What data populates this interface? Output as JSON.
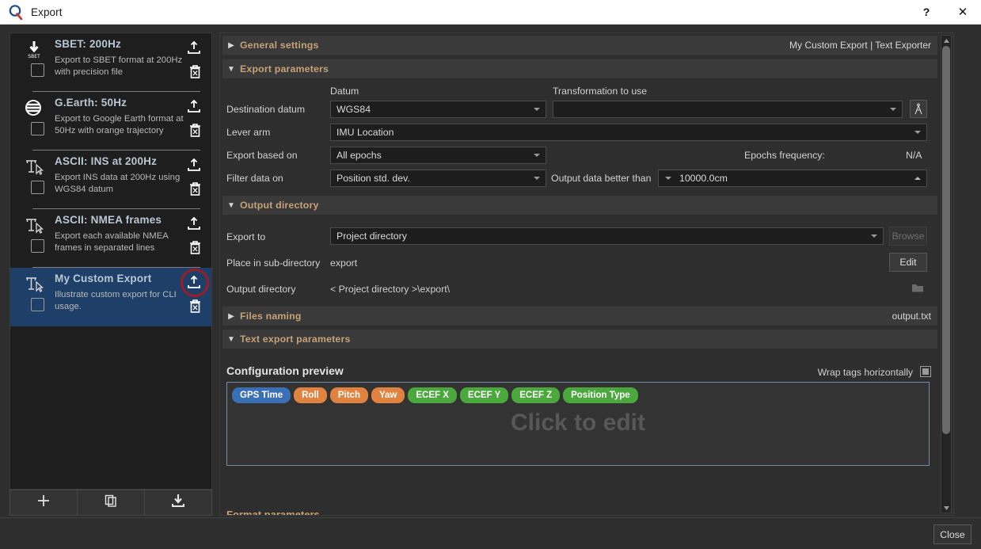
{
  "window": {
    "title": "Export",
    "logo_icon": "app-logo-icon",
    "help_label": "?",
    "close_label": "✕"
  },
  "sidebar": {
    "items": [
      {
        "icon": "sbet-download-icon",
        "title": "SBET: 200Hz",
        "description": "Export to SBET format at 200Hz with precision file",
        "checked": false,
        "selected": false,
        "upload_icon": "upload-icon",
        "delete_icon": "trash-icon"
      },
      {
        "icon": "google-earth-globe-icon",
        "title": "G.Earth: 50Hz",
        "description": "Export to Google Earth format at 50Hz with orange trajectory",
        "checked": false,
        "selected": false,
        "upload_icon": "upload-icon",
        "delete_icon": "trash-icon"
      },
      {
        "icon": "text-exporter-icon",
        "title": "ASCII: INS at 200Hz",
        "description": "Export INS data at 200Hz using WGS84 datum",
        "checked": false,
        "selected": false,
        "upload_icon": "upload-icon",
        "delete_icon": "trash-icon"
      },
      {
        "icon": "text-exporter-icon",
        "title": "ASCII: NMEA frames",
        "description": "Export each available NMEA frames in separated lines",
        "checked": false,
        "selected": false,
        "upload_icon": "upload-icon",
        "delete_icon": "trash-icon"
      },
      {
        "icon": "text-exporter-icon",
        "title": "My Custom Export",
        "description": "Illustrate custom export for CLI usage.",
        "checked": false,
        "selected": true,
        "upload_icon": "upload-icon",
        "delete_icon": "trash-icon",
        "highlighted_control": "upload-icon"
      }
    ],
    "toolbar": {
      "add_icon": "plus-icon",
      "duplicate_icon": "copy-icon",
      "import_icon": "download-icon"
    }
  },
  "panel": {
    "general_settings": {
      "label": "General settings",
      "arrow": "chevron-right-icon",
      "summary": "My Custom Export | Text Exporter"
    },
    "export_parameters": {
      "label": "Export parameters",
      "arrow": "chevron-down-icon",
      "col_datum": "Datum",
      "col_transformation": "Transformation to use",
      "destination_datum_label": "Destination datum",
      "destination_datum_value": "WGS84",
      "transformation_value": "",
      "transformation_icon": "compass-divider-icon",
      "lever_arm_label": "Lever arm",
      "lever_arm_value": "IMU Location",
      "export_based_on_label": "Export based on",
      "export_based_on_value": "All epochs",
      "epochs_frequency_label": "Epochs frequency:",
      "epochs_frequency_value": "N/A",
      "filter_data_on_label": "Filter data on",
      "filter_data_on_value": "Position std. dev.",
      "output_better_label": "Output data better than",
      "output_better_value": "10000.0cm"
    },
    "output_directory": {
      "label": "Output directory",
      "arrow": "chevron-down-icon",
      "export_to_label": "Export to",
      "export_to_value": "Project directory",
      "browse_label": "Browse",
      "sub_directory_label": "Place in sub-directory",
      "sub_directory_value": "export",
      "edit_label": "Edit",
      "output_directory_label": "Output directory",
      "output_directory_value": "< Project directory >\\export\\",
      "folder_icon": "folder-icon"
    },
    "files_naming": {
      "label": "Files naming",
      "arrow": "chevron-right-icon",
      "summary": "output.txt"
    },
    "text_export_parameters": {
      "label": "Text export parameters",
      "arrow": "chevron-down-icon"
    },
    "configuration_preview": {
      "title": "Configuration preview",
      "wrap_label": "Wrap tags horizontally",
      "wrap_checked": true,
      "placeholder": "Click to edit",
      "tags": [
        {
          "label": "GPS Time",
          "color": "blue"
        },
        {
          "label": "Roll",
          "color": "orange"
        },
        {
          "label": "Pitch",
          "color": "orange"
        },
        {
          "label": "Yaw",
          "color": "orange"
        },
        {
          "label": "ECEF X",
          "color": "green"
        },
        {
          "label": "ECEF Y",
          "color": "green"
        },
        {
          "label": "ECEF Z",
          "color": "green"
        },
        {
          "label": "Position Type",
          "color": "green"
        }
      ]
    },
    "next_section_partial": "Format parameters",
    "scrollbar": {
      "up_icon": "scroll-up-icon",
      "down_icon": "scroll-down-icon"
    }
  },
  "footer": {
    "close_label": "Close"
  },
  "colors": {
    "accent_section": "#c7a277",
    "selected_row": "#1e4068",
    "highlight_ring": "#9e1b29",
    "tag_blue": "#3a6fb5",
    "tag_orange": "#e08240",
    "tag_green": "#4aa83c"
  }
}
